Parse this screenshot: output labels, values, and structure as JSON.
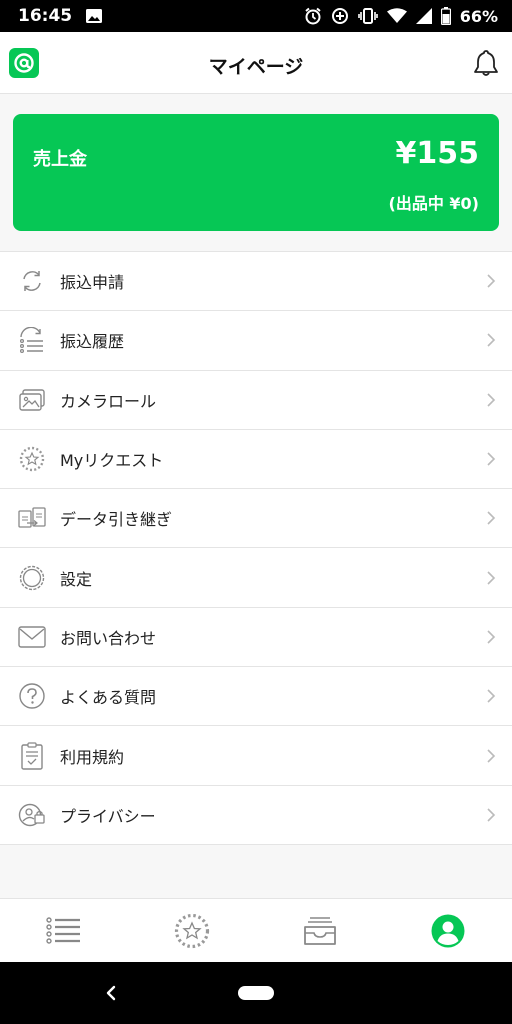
{
  "status_bar": {
    "time": "16:45",
    "battery_percent": "66%"
  },
  "header": {
    "title": "マイページ",
    "logo_glyph": "@"
  },
  "sales_card": {
    "label": "売上金",
    "amount": "¥155",
    "sub": "(出品中 ¥0)",
    "color": "#06c755"
  },
  "menu": {
    "items": [
      {
        "label": "振込申請",
        "icon": "refresh-icon"
      },
      {
        "label": "振込履歴",
        "icon": "history-list-icon"
      },
      {
        "label": "カメラロール",
        "icon": "photo-icon"
      },
      {
        "label": "Myリクエスト",
        "icon": "star-circle-icon"
      },
      {
        "label": "データ引き継ぎ",
        "icon": "transfer-icon"
      },
      {
        "label": "設定",
        "icon": "gear-icon"
      },
      {
        "label": "お問い合わせ",
        "icon": "mail-icon"
      },
      {
        "label": "よくある質問",
        "icon": "question-icon"
      },
      {
        "label": "利用規約",
        "icon": "clipboard-icon"
      },
      {
        "label": "プライバシー",
        "icon": "privacy-icon"
      }
    ]
  },
  "tabbar": {
    "tabs": [
      {
        "icon": "list-icon"
      },
      {
        "icon": "star-circle-icon"
      },
      {
        "icon": "inbox-icon"
      },
      {
        "icon": "profile-icon",
        "active": true
      }
    ],
    "active_color": "#06c755"
  }
}
